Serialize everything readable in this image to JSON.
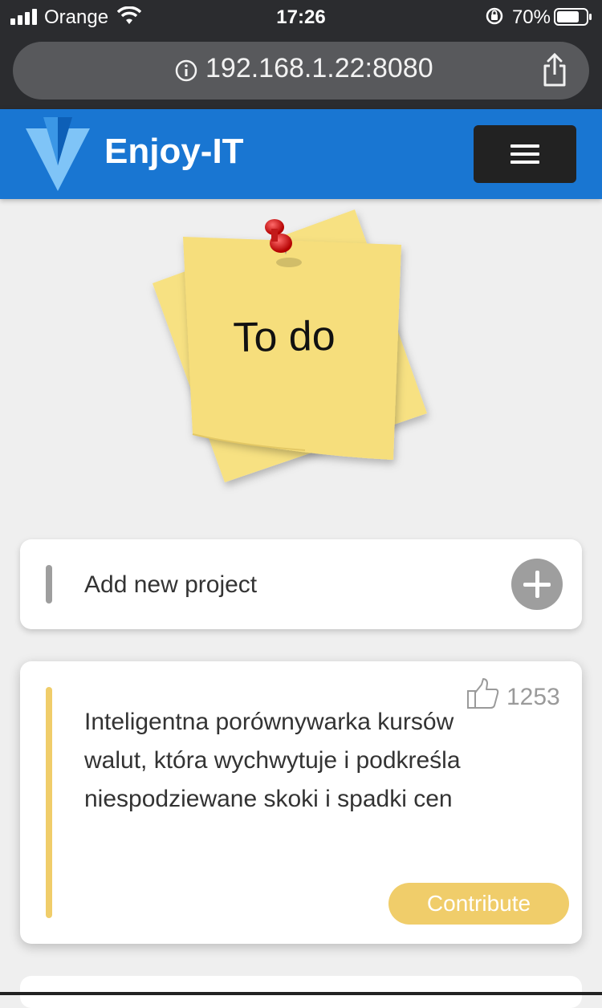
{
  "status_bar": {
    "carrier": "Orange",
    "time": "17:26",
    "battery": "70%"
  },
  "browser": {
    "url": "192.168.1.22:8080"
  },
  "header": {
    "brand": "Enjoy-IT",
    "colors": {
      "bar": "#1976d2",
      "menu_button": "#222222"
    }
  },
  "hero": {
    "note_title": "To do"
  },
  "add_project": {
    "label": "Add new project"
  },
  "projects": [
    {
      "likes": "1253",
      "description": "Inteligentna porównywarka kursów walut, która wychwytuje i podkreśla niespodziewane skoki i spadki cen",
      "contribute_label": "Contribute",
      "accent_color": "#f0cd6a"
    }
  ],
  "icons": {
    "signal": "signal-bars-icon",
    "wifi": "wifi-icon",
    "rotation_lock": "rotation-lock-icon",
    "battery": "battery-icon",
    "info": "info-icon",
    "share": "share-icon",
    "logo": "v-logo-icon",
    "menu": "hamburger-icon",
    "add": "plus-icon",
    "like": "thumbs-up-icon"
  }
}
